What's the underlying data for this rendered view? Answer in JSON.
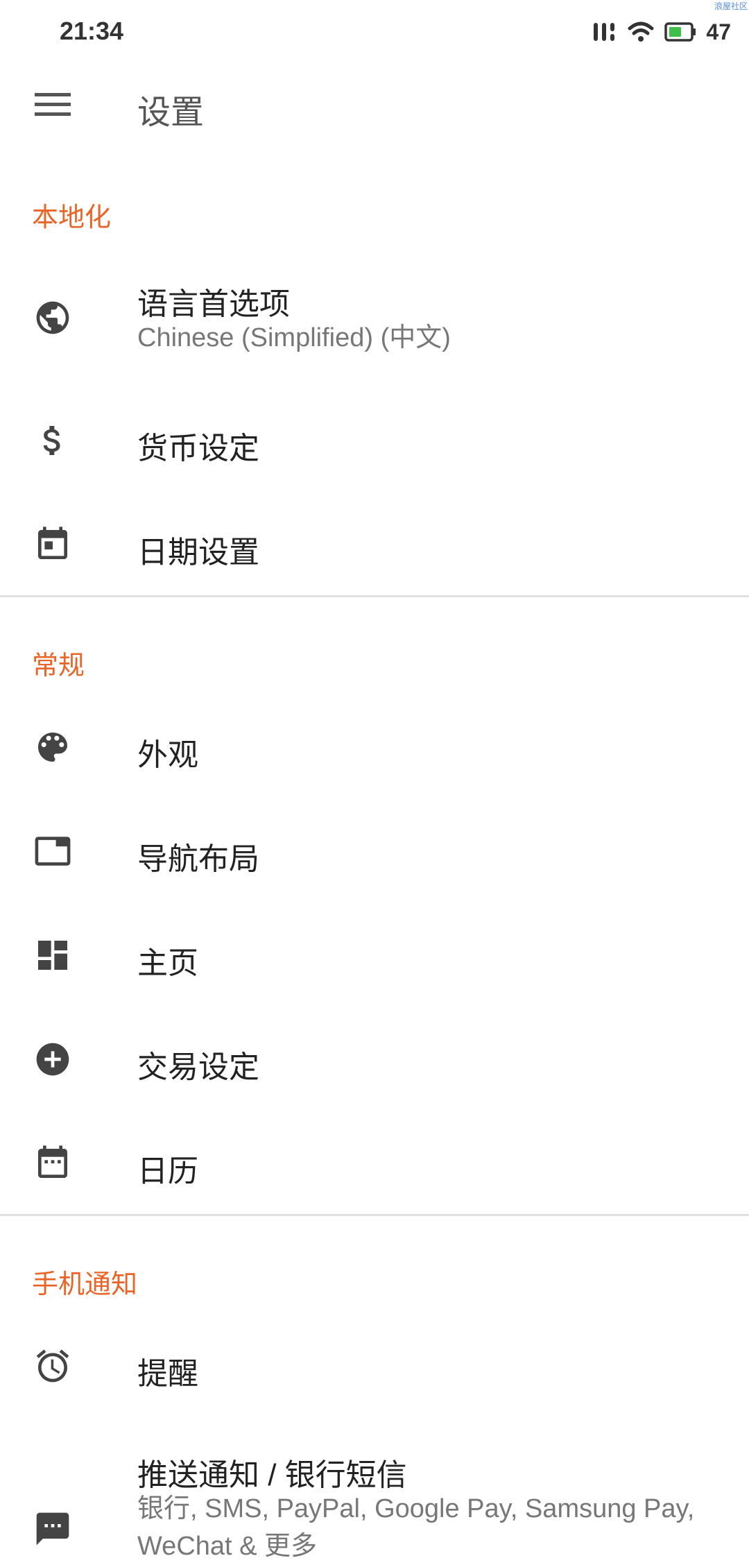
{
  "status_bar": {
    "time": "21:34",
    "battery": "47",
    "watermark": "浪屋社区"
  },
  "app_bar": {
    "title": "设置"
  },
  "sections": {
    "localization": {
      "header": "本地化",
      "items": [
        {
          "title": "语言首选项",
          "subtitle": "Chinese (Simplified) (中文)",
          "icon": "globe-icon"
        },
        {
          "title": "货币设定",
          "icon": "dollar-icon"
        },
        {
          "title": "日期设置",
          "icon": "calendar-day-icon"
        }
      ]
    },
    "general": {
      "header": "常规",
      "items": [
        {
          "title": "外观",
          "icon": "palette-icon"
        },
        {
          "title": "导航布局",
          "icon": "window-icon"
        },
        {
          "title": "主页",
          "icon": "dashboard-icon"
        },
        {
          "title": "交易设定",
          "icon": "add-circle-icon"
        },
        {
          "title": "日历",
          "icon": "calendar-icon"
        }
      ]
    },
    "notifications": {
      "header": "手机通知",
      "items": [
        {
          "title": "提醒",
          "icon": "alarm-icon"
        },
        {
          "title": "推送通知 / 银行短信",
          "subtitle": "银行, SMS, PayPal, Google Pay, Samsung Pay, WeChat & 更多",
          "icon": "message-icon"
        }
      ]
    }
  },
  "colors": {
    "accent": "#e8652a",
    "icon": "#444444",
    "divider": "#e0e0e0"
  }
}
